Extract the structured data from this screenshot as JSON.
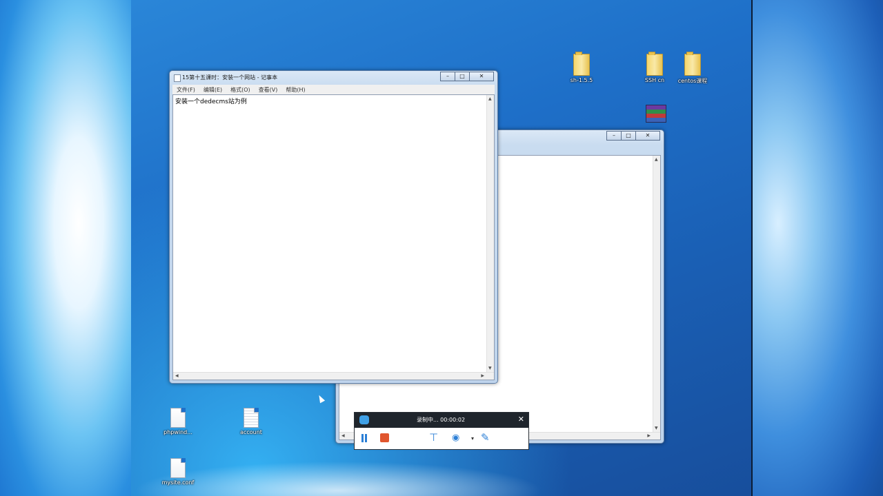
{
  "desktop": {
    "icons": [
      {
        "label": "sh-1.5.5",
        "type": "folder"
      },
      {
        "label": "SSH cn",
        "type": "folder"
      },
      {
        "label": "centos课程",
        "type": "folder"
      },
      {
        "label": "",
        "type": "rar-archive"
      },
      {
        "label": "phpwind...",
        "type": "document"
      },
      {
        "label": "account",
        "type": "document"
      },
      {
        "label": "mysite.conf",
        "type": "document"
      }
    ]
  },
  "notepad": {
    "title": "15第十五课时：安装一个网站 - 记事本",
    "menus": [
      "文件(F)",
      "编辑(E)",
      "格式(O)",
      "查看(V)",
      "帮助(H)"
    ],
    "content": "安装一个dedecms站为例",
    "buttons": {
      "minimize": "–",
      "maximize": "□",
      "close": "✕"
    }
  },
  "back_window": {
    "buttons": {
      "minimize": "–",
      "maximize": "□",
      "close": "✕"
    }
  },
  "recorder": {
    "status": "录制中... 00:00:02",
    "close": "✕",
    "tools": [
      "pause",
      "stop",
      "trim",
      "webcam",
      "pen"
    ]
  }
}
